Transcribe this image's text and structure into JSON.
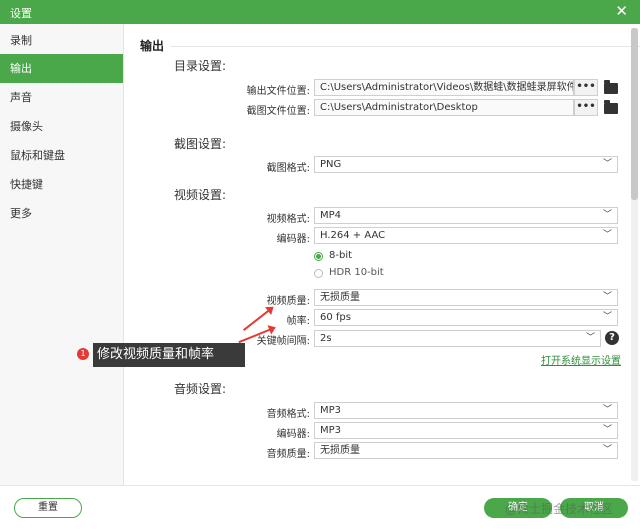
{
  "window": {
    "title": "设置",
    "close_glyph": "✕"
  },
  "sidebar": {
    "items": [
      {
        "label": "录制"
      },
      {
        "label": "输出",
        "active": true
      },
      {
        "label": "声音"
      },
      {
        "label": "摄像头"
      },
      {
        "label": "鼠标和键盘"
      },
      {
        "label": "快捷键"
      },
      {
        "label": "更多"
      }
    ]
  },
  "main": {
    "section_title": "输出",
    "directory": {
      "title": "目录设置:",
      "output_label": "输出文件位置:",
      "output_path": "C:\\Users\\Administrator\\Videos\\数据蛙\\数据蛙录屏软件",
      "screenshot_label": "截图文件位置:",
      "screenshot_path": "C:\\Users\\Administrator\\Desktop",
      "browse_glyph": "•••"
    },
    "screenshot": {
      "title": "截图设置:",
      "format_label": "截图格式:",
      "format_value": "PNG"
    },
    "video": {
      "title": "视频设置:",
      "format_label": "视频格式:",
      "format_value": "MP4",
      "encoder_label": "编码器:",
      "encoder_value": "H.264 + AAC",
      "depth_options": [
        {
          "label": "8-bit",
          "selected": true
        },
        {
          "label": "HDR 10-bit",
          "selected": false
        }
      ],
      "quality_label": "视频质量:",
      "quality_value": "无损质量",
      "fps_label": "帧率:",
      "fps_value": "60 fps",
      "keyframe_label": "关键帧间隔:",
      "keyframe_value": "2s",
      "help_glyph": "?",
      "display_link": "打开系统显示设置"
    },
    "audio": {
      "title": "音频设置:",
      "format_label": "音频格式:",
      "format_value": "MP3",
      "encoder_label": "编码器:",
      "encoder_value": "MP3",
      "quality_label": "音频质量:",
      "quality_value": "无损质量"
    }
  },
  "annotation": {
    "badge": "1",
    "text": "修改视频质量和帧率",
    "color": "#e53935"
  },
  "footer": {
    "reset_label": "重置",
    "confirm_label": "确定",
    "cancel_label": "取消",
    "watermark": "@稀土掘金技术社区"
  },
  "theme": {
    "accent": "#4aa84a",
    "link": "#2f8f3a"
  },
  "icons": {
    "chevron": "chevron-down-icon",
    "folder": "folder-icon",
    "help": "help-icon",
    "close": "close-icon"
  }
}
